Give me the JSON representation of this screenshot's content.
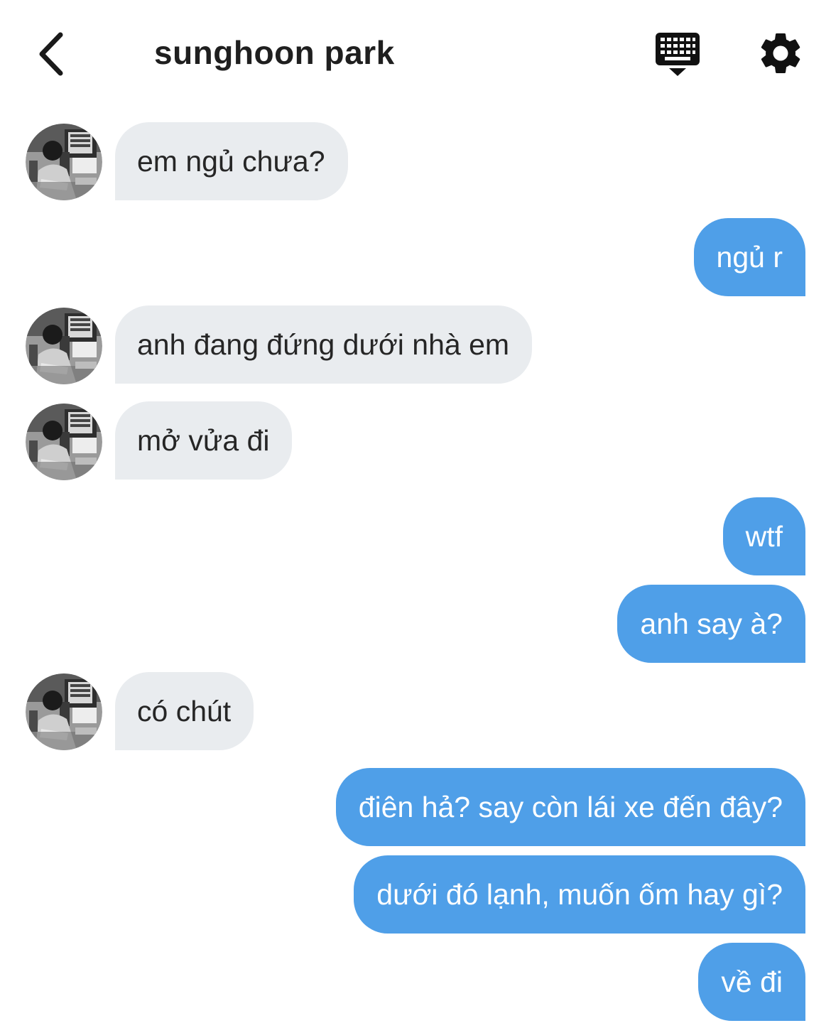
{
  "header": {
    "title": "sunghoon park",
    "back_icon": "chevron-left-icon",
    "keyboard_icon": "keyboard-icon",
    "settings_icon": "gear-icon"
  },
  "colors": {
    "incoming_bubble": "#e9ecef",
    "outgoing_bubble": "#4f9fe8",
    "outgoing_text": "#ffffff"
  },
  "messages": [
    {
      "sender": "sunghoon park",
      "text": "em ngủ chưa?"
    },
    {
      "sender": "me",
      "text": "ngủ r"
    },
    {
      "sender": "sunghoon park",
      "text": "anh đang đứng dưới nhà em"
    },
    {
      "sender": "sunghoon park",
      "text": "mở vửa đi"
    },
    {
      "sender": "me",
      "text": "wtf"
    },
    {
      "sender": "me",
      "text": "anh say à?"
    },
    {
      "sender": "sunghoon park",
      "text": "có chút"
    },
    {
      "sender": "me",
      "text": "điên hả? say còn lái xe đến đây?"
    },
    {
      "sender": "me",
      "text": "dưới đó lạnh, muốn ốm hay gì?"
    },
    {
      "sender": "me",
      "text": "về đi"
    }
  ]
}
